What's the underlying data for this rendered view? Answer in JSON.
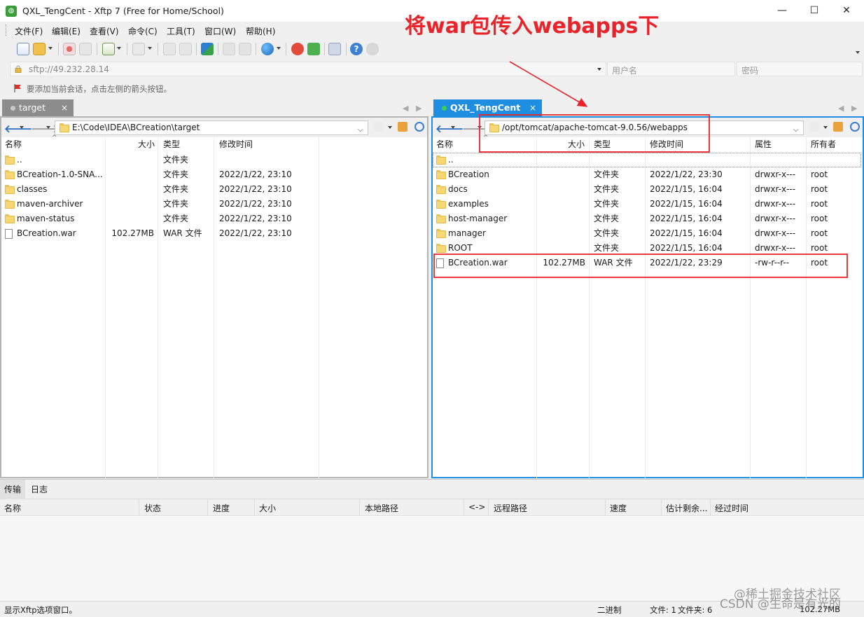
{
  "window": {
    "title": "QXL_TengCent - Xftp 7 (Free for Home/School)",
    "app_icon_glyph": "◍",
    "controls": {
      "minimize": "—",
      "maximize": "☐",
      "close": "✕"
    }
  },
  "menu": [
    "文件(F)",
    "编辑(E)",
    "查看(V)",
    "命令(C)",
    "工具(T)",
    "窗口(W)",
    "帮助(H)"
  ],
  "address": {
    "url": "sftp://49.232.28.14",
    "username_placeholder": "用户名",
    "password_placeholder": "密码"
  },
  "hint": "要添加当前会话，点击左侧的箭头按钮。",
  "left_pane": {
    "tab_label": "target",
    "tab_close": "×",
    "path": "E:\\Code\\IDEA\\BCreation\\target",
    "columns": [
      "名称",
      "大小",
      "类型",
      "修改时间"
    ],
    "rows": [
      {
        "name": "..",
        "size": "",
        "type": "文件夹",
        "modified": "",
        "kind": "folder"
      },
      {
        "name": "BCreation-1.0-SNA...",
        "size": "",
        "type": "文件夹",
        "modified": "2022/1/22, 23:10",
        "kind": "folder"
      },
      {
        "name": "classes",
        "size": "",
        "type": "文件夹",
        "modified": "2022/1/22, 23:10",
        "kind": "folder"
      },
      {
        "name": "maven-archiver",
        "size": "",
        "type": "文件夹",
        "modified": "2022/1/22, 23:10",
        "kind": "folder"
      },
      {
        "name": "maven-status",
        "size": "",
        "type": "文件夹",
        "modified": "2022/1/22, 23:10",
        "kind": "folder"
      },
      {
        "name": "BCreation.war",
        "size": "102.27MB",
        "type": "WAR 文件",
        "modified": "2022/1/22, 23:10",
        "kind": "file"
      }
    ]
  },
  "right_pane": {
    "tab_label": "QXL_TengCent",
    "tab_close": "×",
    "path": "/opt/tomcat/apache-tomcat-9.0.56/webapps",
    "columns": [
      "名称",
      "大小",
      "类型",
      "修改时间",
      "属性",
      "所有者"
    ],
    "rows": [
      {
        "name": "..",
        "size": "",
        "type": "",
        "modified": "",
        "attr": "",
        "owner": "",
        "kind": "folder"
      },
      {
        "name": "BCreation",
        "size": "",
        "type": "文件夹",
        "modified": "2022/1/22, 23:30",
        "attr": "drwxr-x---",
        "owner": "root",
        "kind": "folder"
      },
      {
        "name": "docs",
        "size": "",
        "type": "文件夹",
        "modified": "2022/1/15, 16:04",
        "attr": "drwxr-x---",
        "owner": "root",
        "kind": "folder"
      },
      {
        "name": "examples",
        "size": "",
        "type": "文件夹",
        "modified": "2022/1/15, 16:04",
        "attr": "drwxr-x---",
        "owner": "root",
        "kind": "folder"
      },
      {
        "name": "host-manager",
        "size": "",
        "type": "文件夹",
        "modified": "2022/1/15, 16:04",
        "attr": "drwxr-x---",
        "owner": "root",
        "kind": "folder"
      },
      {
        "name": "manager",
        "size": "",
        "type": "文件夹",
        "modified": "2022/1/15, 16:04",
        "attr": "drwxr-x---",
        "owner": "root",
        "kind": "folder"
      },
      {
        "name": "ROOT",
        "size": "",
        "type": "文件夹",
        "modified": "2022/1/15, 16:04",
        "attr": "drwxr-x---",
        "owner": "root",
        "kind": "folder"
      },
      {
        "name": "BCreation.war",
        "size": "102.27MB",
        "type": "WAR 文件",
        "modified": "2022/1/22, 23:29",
        "attr": "-rw-r--r--",
        "owner": "root",
        "kind": "file"
      }
    ]
  },
  "transfer": {
    "tabs": [
      "传输",
      "日志"
    ],
    "columns": [
      "名称",
      "状态",
      "进度",
      "大小",
      "本地路径",
      "<->",
      "远程路径",
      "速度",
      "估计剩余...",
      "经过时间"
    ]
  },
  "status": {
    "left": "显示Xftp选项窗口。",
    "mode": "二进制",
    "files": "文件: 1",
    "folders": "文件夹: 6",
    "size": "102.27MB"
  },
  "annotation": {
    "caption": "将war包传入webapps下",
    "color": "#e8242a"
  },
  "watermark": "@稀土掘金技术社区\nCSDN @生命是有光的",
  "colors": {
    "accent_blue": "#1e8fe0",
    "inactive_tab": "#8d8d8d",
    "folder_yellow": "#f7d774"
  }
}
